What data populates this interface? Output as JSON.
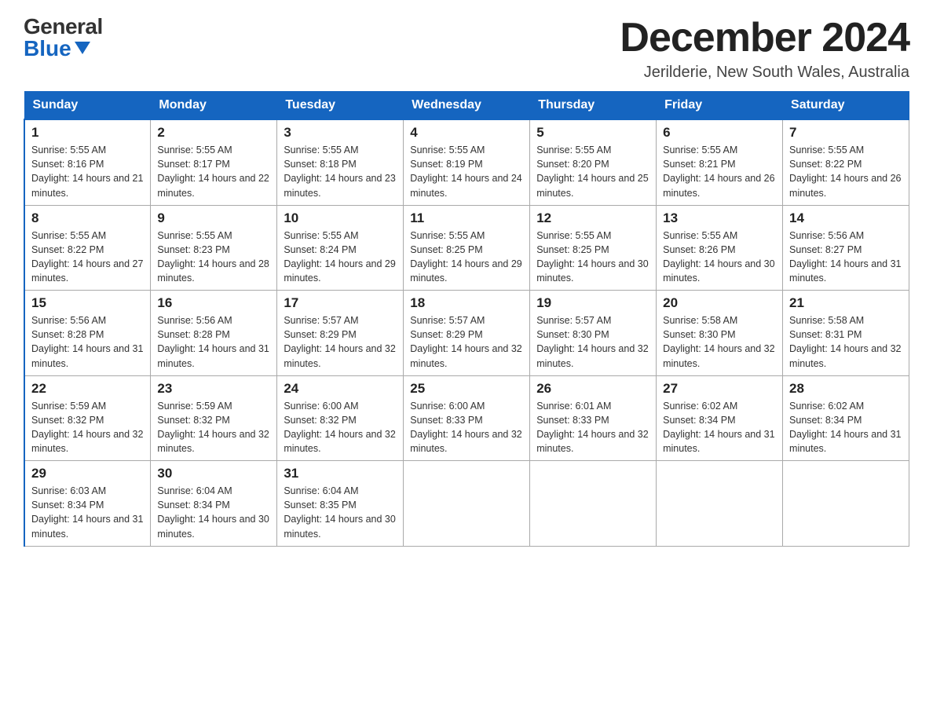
{
  "header": {
    "logo": {
      "general": "General",
      "blue": "Blue"
    },
    "title": "December 2024",
    "location": "Jerilderie, New South Wales, Australia"
  },
  "days_of_week": [
    "Sunday",
    "Monday",
    "Tuesday",
    "Wednesday",
    "Thursday",
    "Friday",
    "Saturday"
  ],
  "weeks": [
    [
      {
        "day": 1,
        "sunrise": "5:55 AM",
        "sunset": "8:16 PM",
        "daylight": "14 hours and 21 minutes."
      },
      {
        "day": 2,
        "sunrise": "5:55 AM",
        "sunset": "8:17 PM",
        "daylight": "14 hours and 22 minutes."
      },
      {
        "day": 3,
        "sunrise": "5:55 AM",
        "sunset": "8:18 PM",
        "daylight": "14 hours and 23 minutes."
      },
      {
        "day": 4,
        "sunrise": "5:55 AM",
        "sunset": "8:19 PM",
        "daylight": "14 hours and 24 minutes."
      },
      {
        "day": 5,
        "sunrise": "5:55 AM",
        "sunset": "8:20 PM",
        "daylight": "14 hours and 25 minutes."
      },
      {
        "day": 6,
        "sunrise": "5:55 AM",
        "sunset": "8:21 PM",
        "daylight": "14 hours and 26 minutes."
      },
      {
        "day": 7,
        "sunrise": "5:55 AM",
        "sunset": "8:22 PM",
        "daylight": "14 hours and 26 minutes."
      }
    ],
    [
      {
        "day": 8,
        "sunrise": "5:55 AM",
        "sunset": "8:22 PM",
        "daylight": "14 hours and 27 minutes."
      },
      {
        "day": 9,
        "sunrise": "5:55 AM",
        "sunset": "8:23 PM",
        "daylight": "14 hours and 28 minutes."
      },
      {
        "day": 10,
        "sunrise": "5:55 AM",
        "sunset": "8:24 PM",
        "daylight": "14 hours and 29 minutes."
      },
      {
        "day": 11,
        "sunrise": "5:55 AM",
        "sunset": "8:25 PM",
        "daylight": "14 hours and 29 minutes."
      },
      {
        "day": 12,
        "sunrise": "5:55 AM",
        "sunset": "8:25 PM",
        "daylight": "14 hours and 30 minutes."
      },
      {
        "day": 13,
        "sunrise": "5:55 AM",
        "sunset": "8:26 PM",
        "daylight": "14 hours and 30 minutes."
      },
      {
        "day": 14,
        "sunrise": "5:56 AM",
        "sunset": "8:27 PM",
        "daylight": "14 hours and 31 minutes."
      }
    ],
    [
      {
        "day": 15,
        "sunrise": "5:56 AM",
        "sunset": "8:28 PM",
        "daylight": "14 hours and 31 minutes."
      },
      {
        "day": 16,
        "sunrise": "5:56 AM",
        "sunset": "8:28 PM",
        "daylight": "14 hours and 31 minutes."
      },
      {
        "day": 17,
        "sunrise": "5:57 AM",
        "sunset": "8:29 PM",
        "daylight": "14 hours and 32 minutes."
      },
      {
        "day": 18,
        "sunrise": "5:57 AM",
        "sunset": "8:29 PM",
        "daylight": "14 hours and 32 minutes."
      },
      {
        "day": 19,
        "sunrise": "5:57 AM",
        "sunset": "8:30 PM",
        "daylight": "14 hours and 32 minutes."
      },
      {
        "day": 20,
        "sunrise": "5:58 AM",
        "sunset": "8:30 PM",
        "daylight": "14 hours and 32 minutes."
      },
      {
        "day": 21,
        "sunrise": "5:58 AM",
        "sunset": "8:31 PM",
        "daylight": "14 hours and 32 minutes."
      }
    ],
    [
      {
        "day": 22,
        "sunrise": "5:59 AM",
        "sunset": "8:32 PM",
        "daylight": "14 hours and 32 minutes."
      },
      {
        "day": 23,
        "sunrise": "5:59 AM",
        "sunset": "8:32 PM",
        "daylight": "14 hours and 32 minutes."
      },
      {
        "day": 24,
        "sunrise": "6:00 AM",
        "sunset": "8:32 PM",
        "daylight": "14 hours and 32 minutes."
      },
      {
        "day": 25,
        "sunrise": "6:00 AM",
        "sunset": "8:33 PM",
        "daylight": "14 hours and 32 minutes."
      },
      {
        "day": 26,
        "sunrise": "6:01 AM",
        "sunset": "8:33 PM",
        "daylight": "14 hours and 32 minutes."
      },
      {
        "day": 27,
        "sunrise": "6:02 AM",
        "sunset": "8:34 PM",
        "daylight": "14 hours and 31 minutes."
      },
      {
        "day": 28,
        "sunrise": "6:02 AM",
        "sunset": "8:34 PM",
        "daylight": "14 hours and 31 minutes."
      }
    ],
    [
      {
        "day": 29,
        "sunrise": "6:03 AM",
        "sunset": "8:34 PM",
        "daylight": "14 hours and 31 minutes."
      },
      {
        "day": 30,
        "sunrise": "6:04 AM",
        "sunset": "8:34 PM",
        "daylight": "14 hours and 30 minutes."
      },
      {
        "day": 31,
        "sunrise": "6:04 AM",
        "sunset": "8:35 PM",
        "daylight": "14 hours and 30 minutes."
      },
      null,
      null,
      null,
      null
    ]
  ]
}
